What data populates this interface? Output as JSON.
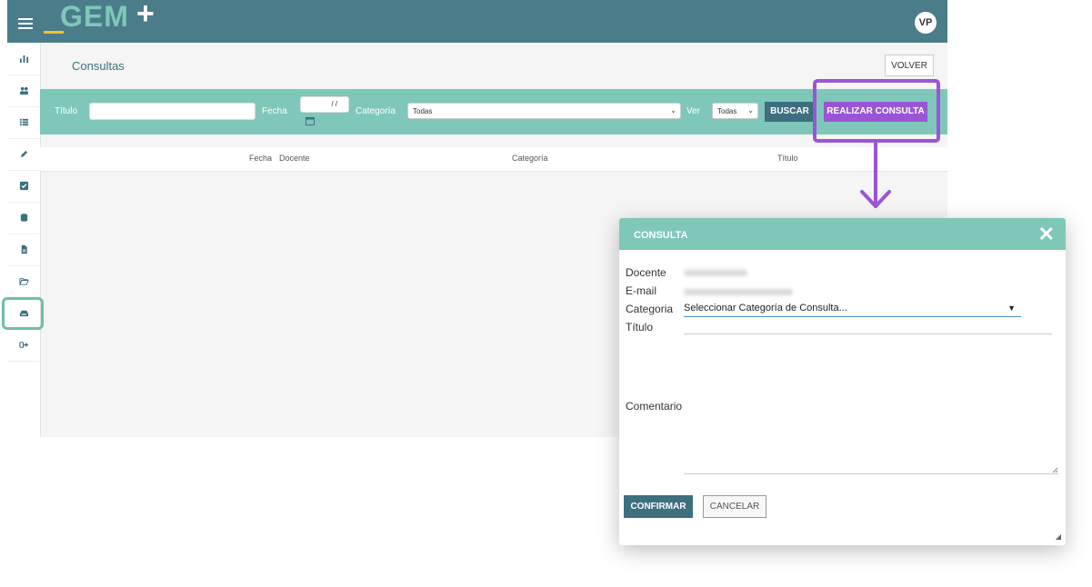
{
  "topbar": {
    "logo_text": "GEM",
    "logo_plus": "+",
    "avatar_initials": "VP",
    "accent_color": "#4a7c8a",
    "logo_color": "#7fc7b9"
  },
  "sidebar": {
    "items": [
      {
        "name": "dashboard-icon"
      },
      {
        "name": "users-icon"
      },
      {
        "name": "list-icon"
      },
      {
        "name": "pencil-icon"
      },
      {
        "name": "checkbox-icon"
      },
      {
        "name": "database-icon"
      },
      {
        "name": "document-icon"
      },
      {
        "name": "folder-open-icon"
      },
      {
        "name": "inbox-icon",
        "active": true
      },
      {
        "name": "logout-icon"
      }
    ]
  },
  "page": {
    "title": "Consultas",
    "volver_label": "VOLVER"
  },
  "filters": {
    "titulo_label": "Título",
    "titulo_value": "",
    "fecha_label": "Fecha",
    "fecha_value": "/ /",
    "categoria_label": "Categoría",
    "categoria_selected": "Todas",
    "ver_label": "Ver",
    "ver_selected": "Todas",
    "buscar_label": "BUSCAR",
    "realizar_label": "REALIZAR CONSULTA",
    "bar_color": "#7fc7b9",
    "highlight_color": "#9a55d6"
  },
  "table": {
    "columns": [
      "Fecha",
      "Docente",
      "Categoría",
      "Título"
    ]
  },
  "modal": {
    "title": "CONSULTA",
    "close_glyph": "✕",
    "docente_label": "Docente",
    "email_label": "E-mail",
    "categoria_label": "Categoria",
    "categoria_placeholder": "Seleccionar Categoría de Consulta...",
    "titulo_label": "Título",
    "comentario_label": "Comentario",
    "confirmar_label": "CONFIRMAR",
    "cancelar_label": "CANCELAR"
  }
}
